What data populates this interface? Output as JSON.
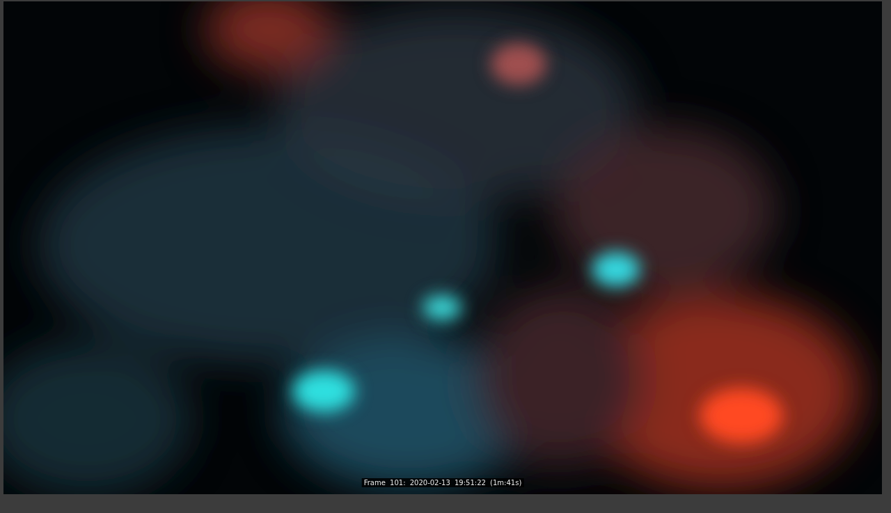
{
  "viewer": {
    "caption": "Frame 101: 2020-02-13 19:51:22 (1m:41s)"
  }
}
